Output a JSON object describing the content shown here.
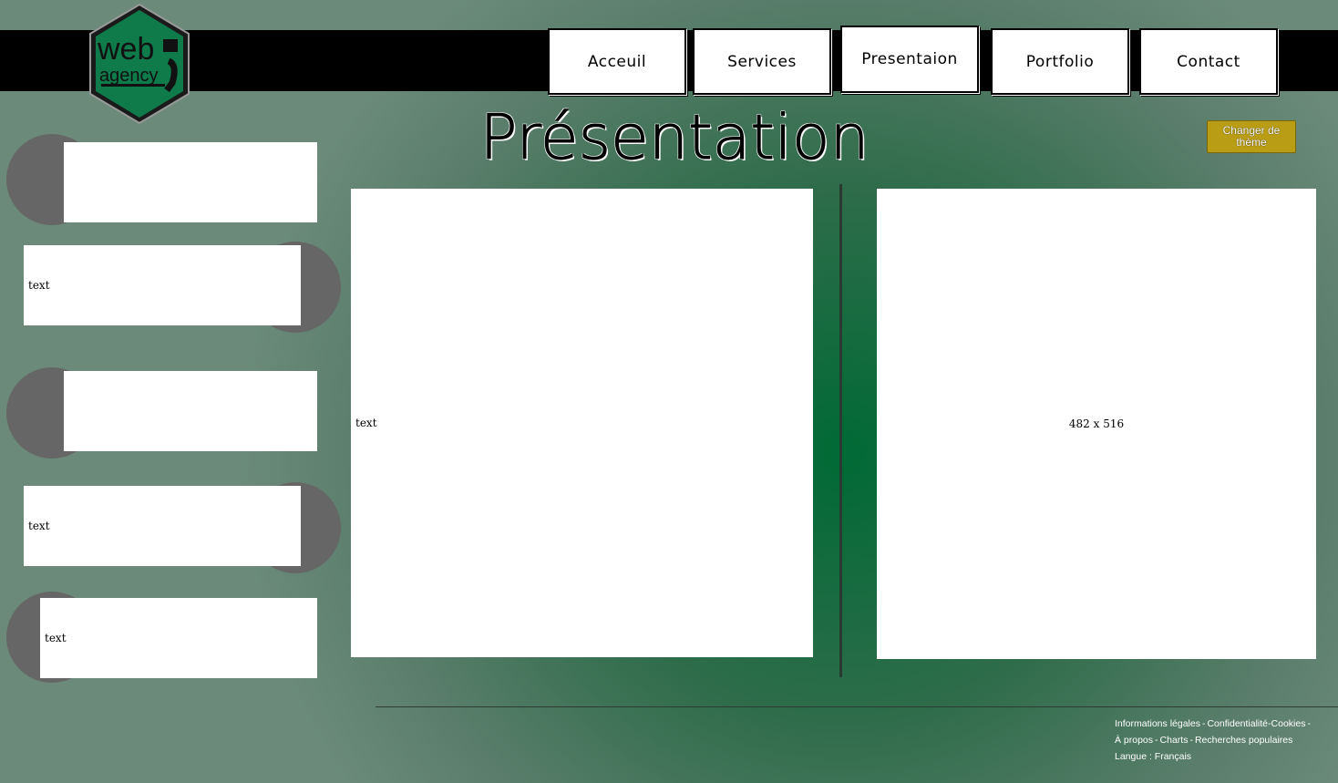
{
  "nav": {
    "items": [
      "Acceuil",
      "Services",
      "Presentaion",
      "Portfolio",
      "Contact"
    ]
  },
  "logo": {
    "line1": "web",
    "line2": "agency"
  },
  "page": {
    "title": "Présentation"
  },
  "theme_button": {
    "label": "Changer de thème"
  },
  "sidebar": {
    "cards": [
      "",
      "text",
      "",
      "text",
      "text"
    ]
  },
  "main": {
    "text_panel": "text",
    "image_placeholder": "482 x 516"
  },
  "footer": {
    "links": [
      "Informations légales",
      "Confidentialité",
      "Cookies",
      "À propos",
      "Charts",
      "Recherches populaires"
    ],
    "language": "Langue : Français"
  },
  "colors": {
    "accent": "#b99d14",
    "bg_green": "#006a35",
    "circle": "#666666"
  }
}
